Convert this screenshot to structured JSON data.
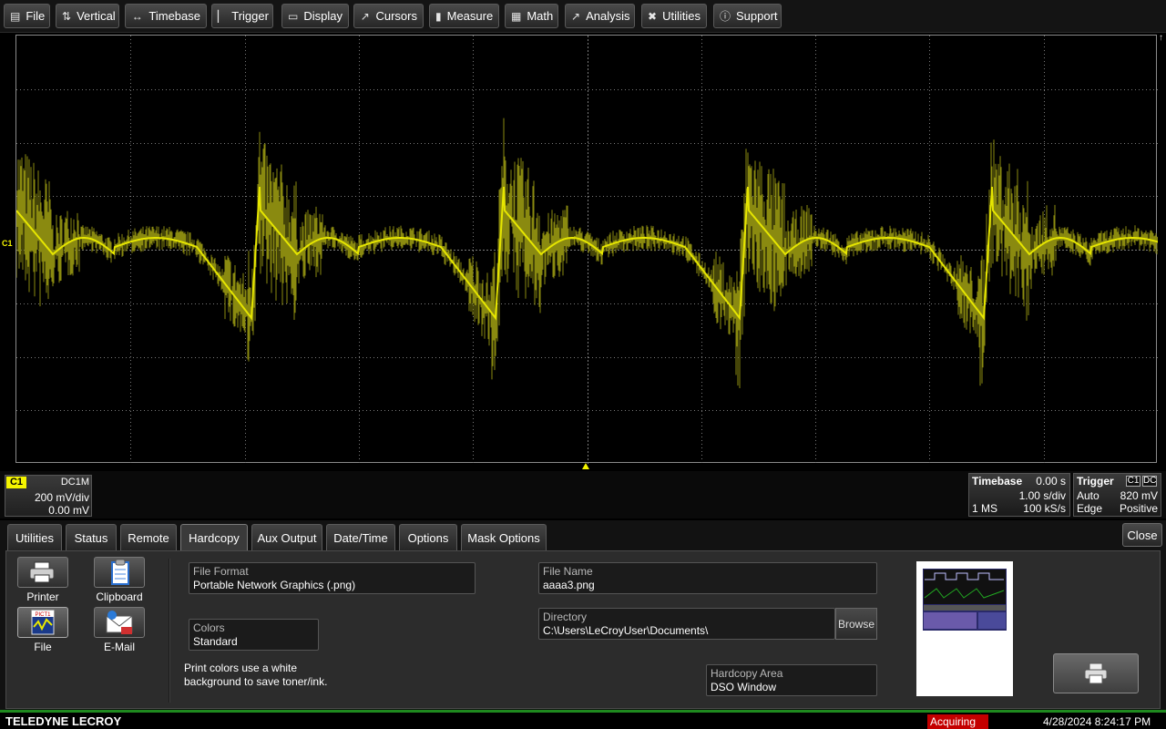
{
  "menu": [
    {
      "label": "File",
      "icon": "clipboard-icon",
      "glyph": "▤"
    },
    {
      "label": "Vertical",
      "icon": "vertical-arrows-icon",
      "glyph": "⇅"
    },
    {
      "label": "Timebase",
      "icon": "horizontal-arrows-icon",
      "glyph": "↔"
    },
    {
      "label": "Trigger",
      "icon": "trigger-edge-icon",
      "glyph": "▏"
    },
    {
      "label": "Display",
      "icon": "display-icon",
      "glyph": "▭"
    },
    {
      "label": "Cursors",
      "icon": "cursor-icon",
      "glyph": "↗"
    },
    {
      "label": "Measure",
      "icon": "measure-icon",
      "glyph": "▮"
    },
    {
      "label": "Math",
      "icon": "calculator-icon",
      "glyph": "▦"
    },
    {
      "label": "Analysis",
      "icon": "analysis-chart-icon",
      "glyph": "↗"
    },
    {
      "label": "Utilities",
      "icon": "tools-icon",
      "glyph": "✖"
    },
    {
      "label": "Support",
      "icon": "info-icon",
      "glyph": "ⓘ"
    }
  ],
  "display": {
    "channel_marker": "C1",
    "trace_color": "#E6E600",
    "grid_color": "#7a7a7a"
  },
  "channel": {
    "tag": "C1",
    "coupling": "DC1M",
    "vdiv": "200 mV/div",
    "offset": "0.00 mV",
    "color": "#F4F400"
  },
  "timebase": {
    "title": "Timebase",
    "delay": "0.00 s",
    "tdiv": "1.00 s/div",
    "samples": "1 MS",
    "rate": "100 kS/s"
  },
  "trigger": {
    "title": "Trigger",
    "source": "C1",
    "coupling": "DC",
    "mode": "Auto",
    "level": "820 mV",
    "type": "Edge",
    "slope": "Positive"
  },
  "tabs": [
    {
      "label": "Utilities",
      "active": false
    },
    {
      "label": "Status",
      "active": false
    },
    {
      "label": "Remote",
      "active": false
    },
    {
      "label": "Hardcopy",
      "active": true
    },
    {
      "label": "Aux Output",
      "active": false
    },
    {
      "label": "Date/Time",
      "active": false
    },
    {
      "label": "Options",
      "active": false
    },
    {
      "label": "Mask Options",
      "active": false
    }
  ],
  "close_label": "Close",
  "hardcopy": {
    "destinations": [
      {
        "label": "Printer",
        "icon": "printer-icon",
        "selected": false
      },
      {
        "label": "Clipboard",
        "icon": "clipboard-icon",
        "selected": false
      },
      {
        "label": "File",
        "icon": "file-image-icon",
        "selected": true
      },
      {
        "label": "E-Mail",
        "icon": "email-icon",
        "selected": false
      }
    ],
    "file_format": {
      "label": "File Format",
      "value": "Portable Network Graphics (.png)"
    },
    "colors": {
      "label": "Colors",
      "value": "Standard"
    },
    "colors_note_line1": "Print colors use a white",
    "colors_note_line2": "background to save toner/ink.",
    "file_name": {
      "label": "File Name",
      "value": "aaaa3.png"
    },
    "directory": {
      "label": "Directory",
      "value": "C:\\Users\\LeCroyUser\\Documents\\"
    },
    "browse_label": "Browse",
    "hardcopy_area": {
      "label": "Hardcopy Area",
      "value": "DSO Window"
    },
    "print_icon": "printer-icon",
    "pict_label": "PICT1"
  },
  "status": {
    "brand": "TELEDYNE LECROY",
    "acquiring": "Acquiring",
    "acquiring_color": "#C40000",
    "datetime": "4/28/2024 8:24:17 PM"
  }
}
